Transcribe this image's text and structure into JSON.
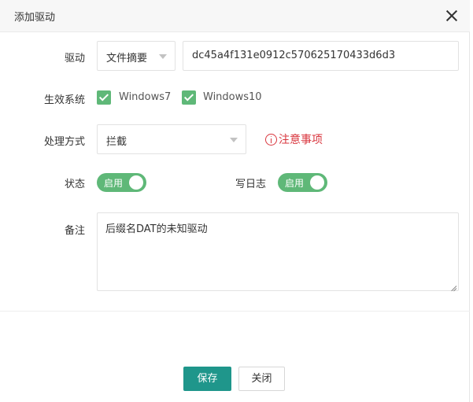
{
  "dialog": {
    "title": "添加驱动"
  },
  "form": {
    "driver": {
      "label": "驱动",
      "type_select": "文件摘要",
      "hash_value": "dc45a4f131e0912c570625170433d6d3"
    },
    "systems": {
      "label": "生效系统",
      "options": [
        {
          "label": "Windows7",
          "checked": true
        },
        {
          "label": "Windows10",
          "checked": true
        }
      ]
    },
    "handling": {
      "label": "处理方式",
      "selected": "拦截",
      "notice": "注意事项"
    },
    "status": {
      "label": "状态",
      "switch_text": "启用",
      "on": true
    },
    "log": {
      "label": "写日志",
      "switch_text": "启用",
      "on": true
    },
    "remark": {
      "label": "备注",
      "value": "后缀名DAT的未知驱动"
    }
  },
  "footer": {
    "save_label": "保存",
    "close_label": "关闭"
  },
  "colors": {
    "accent_green": "#5fb878",
    "primary_button": "#1f968b",
    "notice_red": "#d9363e"
  },
  "icons": {
    "close": "close-icon",
    "notice": "info-circle-icon",
    "select_caret": "caret-down-icon",
    "checkbox_check": "check-icon"
  }
}
